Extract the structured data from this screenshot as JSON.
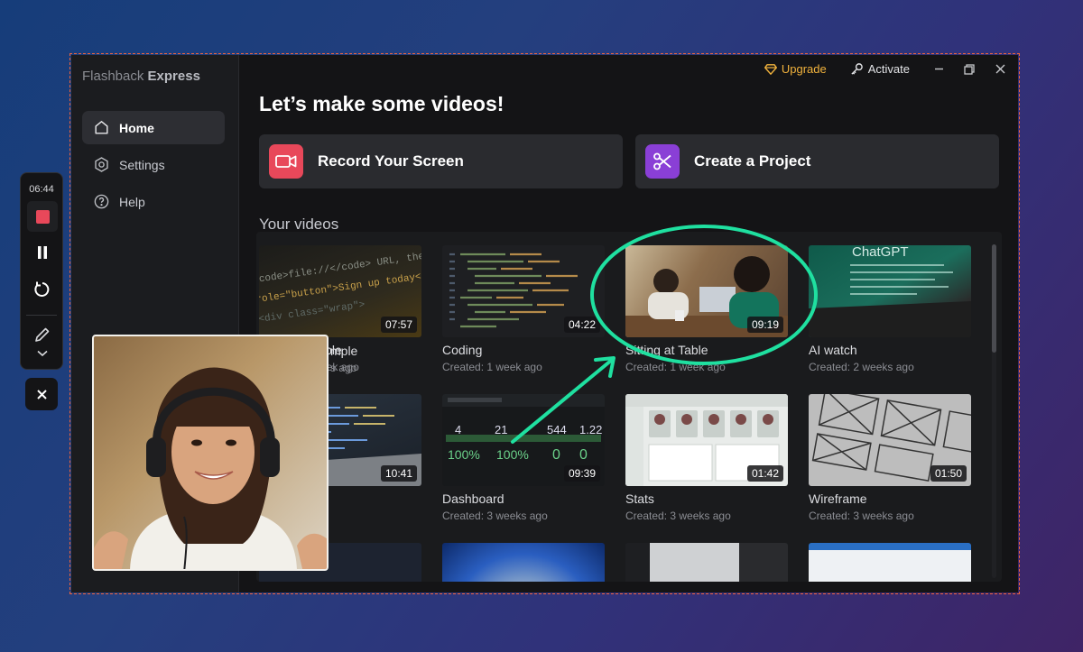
{
  "app": {
    "brand_light": "Flashback",
    "brand_bold": "Express"
  },
  "sidebar": {
    "items": [
      {
        "label": "Home",
        "icon": "home-icon",
        "active": true
      },
      {
        "label": "Settings",
        "icon": "gear-icon",
        "active": false
      },
      {
        "label": "Help",
        "icon": "help-icon",
        "active": false
      }
    ]
  },
  "titlebar": {
    "upgrade_label": "Upgrade",
    "activate_label": "Activate"
  },
  "main": {
    "title": "Let’s make some videos!",
    "record_label": "Record Your Screen",
    "project_label": "Create a Project",
    "videos_title": "Your videos"
  },
  "videos": [
    {
      "title": "Code Example",
      "title_visible": "mple",
      "date": "Created: 1 week ago",
      "date_visible": "s ago",
      "duration": "07:57"
    },
    {
      "title": "Coding",
      "date": "Created: 1 week ago",
      "duration": "04:22"
    },
    {
      "title": "Sitting at Table",
      "date": "Created: 1 week ago",
      "duration": "09:19"
    },
    {
      "title": "AI watch",
      "date": "Created: 2 weeks ago",
      "duration": ""
    },
    {
      "title": "",
      "date_visible": "eks ago",
      "duration": "10:41"
    },
    {
      "title": "Dashboard",
      "date": "Created: 3 weeks ago",
      "duration": "09:39"
    },
    {
      "title": "Stats",
      "date": "Created: 3 weeks ago",
      "duration": "01:42"
    },
    {
      "title": "Wireframe",
      "date": "Created: 3 weeks ago",
      "duration": "01:50"
    }
  ],
  "recorder": {
    "time": "06:44"
  },
  "dashboard_thumb": {
    "values": [
      "4",
      "21",
      "544",
      "1.22",
      "100%",
      "100%",
      "0",
      "0"
    ]
  },
  "chatgpt_thumb": {
    "text": "ChatGPT"
  },
  "colors": {
    "accent_upgrade": "#f2b33d",
    "record_icon_bg": "#e8485a",
    "project_icon_bg": "#8a3fd6",
    "highlight": "#1fe0a0",
    "capture_border": "#f0643c"
  }
}
